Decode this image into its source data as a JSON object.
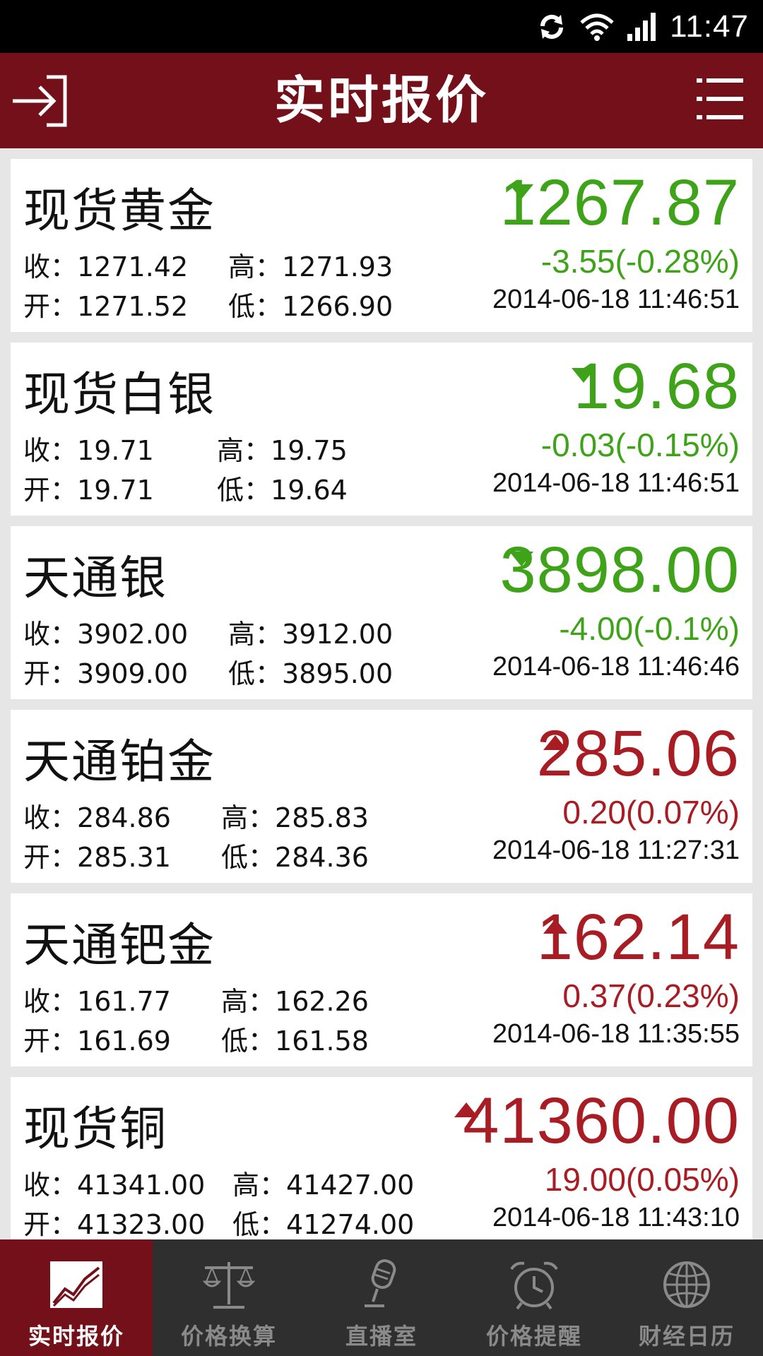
{
  "status_bar": {
    "time": "11:47",
    "icons": [
      "sync-icon",
      "wifi-icon",
      "signal-icon"
    ]
  },
  "app_bar": {
    "title": "实时报价",
    "left_icon": "login-arrow-icon",
    "right_icon": "menu-icon"
  },
  "labels": {
    "close": "收：",
    "high": "高：",
    "open": "开：",
    "low": "低："
  },
  "colors": {
    "header": "#731019",
    "up": "#a81c24",
    "down": "#3fa31a",
    "tab_bar": "#2f2f2f"
  },
  "quotes": [
    {
      "name": "现货黄金",
      "price": "1267.87",
      "direction": "down",
      "change": "-3.55(-0.28%)",
      "close": "1271.42",
      "high": "1271.93",
      "open": "1271.52",
      "low": "1266.90",
      "time": "2014-06-18 11:46:51"
    },
    {
      "name": "现货白银",
      "price": "19.68",
      "direction": "down",
      "change": "-0.03(-0.15%)",
      "close": "19.71",
      "high": "19.75",
      "open": "19.71",
      "low": "19.64",
      "time": "2014-06-18 11:46:51"
    },
    {
      "name": "天通银",
      "price": "3898.00",
      "direction": "down",
      "change": "-4.00(-0.1%)",
      "close": "3902.00",
      "high": "3912.00",
      "open": "3909.00",
      "low": "3895.00",
      "time": "2014-06-18 11:46:46"
    },
    {
      "name": "天通铂金",
      "price": "285.06",
      "direction": "up",
      "change": "0.20(0.07%)",
      "close": "284.86",
      "high": "285.83",
      "open": "285.31",
      "low": "284.36",
      "time": "2014-06-18 11:27:31"
    },
    {
      "name": "天通钯金",
      "price": "162.14",
      "direction": "up",
      "change": "0.37(0.23%)",
      "close": "161.77",
      "high": "162.26",
      "open": "161.69",
      "low": "161.58",
      "time": "2014-06-18 11:35:55"
    },
    {
      "name": "现货铜",
      "price": "41360.00",
      "direction": "up",
      "change": "19.00(0.05%)",
      "close": "41341.00",
      "high": "41427.00",
      "open": "41323.00",
      "low": "41274.00",
      "time": "2014-06-18 11:43:10"
    }
  ],
  "tabs": [
    {
      "label": "实时报价",
      "icon": "line-chart-icon",
      "active": true
    },
    {
      "label": "价格换算",
      "icon": "balance-scale-icon",
      "active": false
    },
    {
      "label": "直播室",
      "icon": "microphone-icon",
      "active": false
    },
    {
      "label": "价格提醒",
      "icon": "alarm-clock-icon",
      "active": false
    },
    {
      "label": "财经日历",
      "icon": "globe-icon",
      "active": false
    }
  ]
}
